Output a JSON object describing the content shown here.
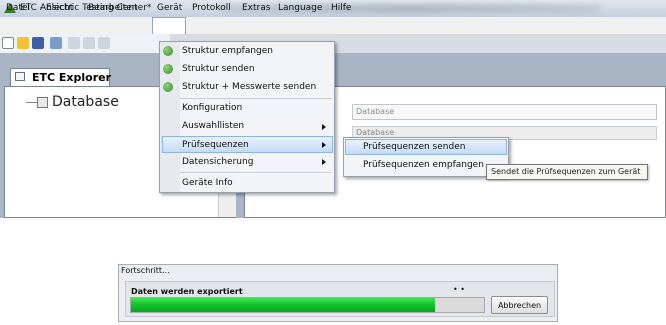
{
  "window": {
    "title": "ETC - Electric Testing Center*"
  },
  "menubar": {
    "items": [
      "Datei",
      "Ansicht",
      "Bearbeiten",
      "Gerät",
      "Protokoll",
      "Extras",
      "Language",
      "Hilfe"
    ],
    "active": "Gerät"
  },
  "explorer": {
    "tab_title": "ETC Explorer",
    "tree_root": "Database"
  },
  "content": {
    "field1": "Database",
    "field2": "Database"
  },
  "geraet_menu": {
    "items": [
      {
        "label": "Struktur empfangen",
        "icon": "green-arrow-icon"
      },
      {
        "label": "Struktur senden",
        "icon": "green-arrow-icon"
      },
      {
        "label": "Struktur + Messwerte senden",
        "icon": "green-arrow-icon"
      },
      {
        "label": "Konfiguration"
      },
      {
        "label": "Auswahllisten",
        "submenu": true
      },
      {
        "label": "Prüfsequenzen",
        "submenu": true,
        "highlighted": true
      },
      {
        "label": "Datensicherung",
        "submenu": true
      },
      {
        "label": "Geräte Info"
      }
    ]
  },
  "pruefsequenzen_submenu": {
    "items": [
      {
        "label": "Prüfsequenzen senden",
        "highlighted": true
      },
      {
        "label": "Prüfsequenzen empfangen"
      }
    ]
  },
  "tooltip": {
    "text": "Sendet die Prüfsequenzen zum Gerät"
  },
  "progress_dialog": {
    "title": "Fortschritt...",
    "status": "Daten werden exportiert",
    "dots": "• •",
    "progress_fraction": 0.86,
    "cancel_label": "Abbrechen"
  },
  "colors": {
    "progress_green": "#0fbe2a",
    "menu_highlight": "#c5dcf6",
    "workarea_bg": "#a9b5c5"
  }
}
